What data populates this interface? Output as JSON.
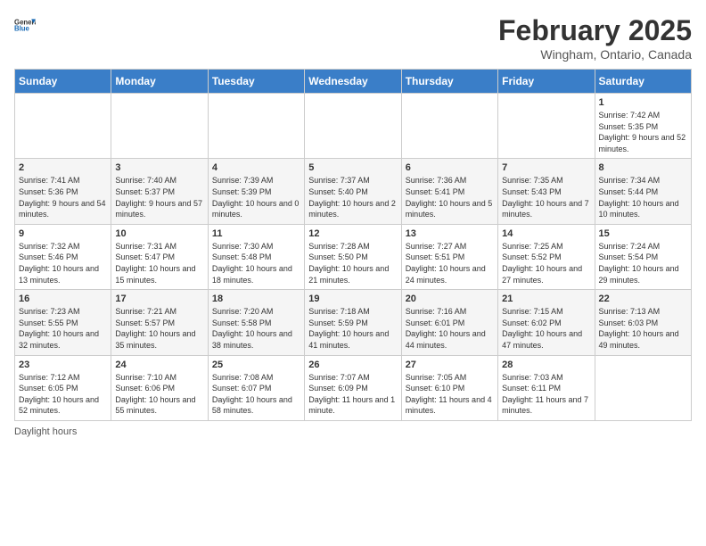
{
  "header": {
    "logo_line1": "General",
    "logo_line2": "Blue",
    "month_year": "February 2025",
    "location": "Wingham, Ontario, Canada"
  },
  "weekdays": [
    "Sunday",
    "Monday",
    "Tuesday",
    "Wednesday",
    "Thursday",
    "Friday",
    "Saturday"
  ],
  "weeks": [
    [
      {
        "day": "",
        "info": ""
      },
      {
        "day": "",
        "info": ""
      },
      {
        "day": "",
        "info": ""
      },
      {
        "day": "",
        "info": ""
      },
      {
        "day": "",
        "info": ""
      },
      {
        "day": "",
        "info": ""
      },
      {
        "day": "1",
        "info": "Sunrise: 7:42 AM\nSunset: 5:35 PM\nDaylight: 9 hours and 52 minutes."
      }
    ],
    [
      {
        "day": "2",
        "info": "Sunrise: 7:41 AM\nSunset: 5:36 PM\nDaylight: 9 hours and 54 minutes."
      },
      {
        "day": "3",
        "info": "Sunrise: 7:40 AM\nSunset: 5:37 PM\nDaylight: 9 hours and 57 minutes."
      },
      {
        "day": "4",
        "info": "Sunrise: 7:39 AM\nSunset: 5:39 PM\nDaylight: 10 hours and 0 minutes."
      },
      {
        "day": "5",
        "info": "Sunrise: 7:37 AM\nSunset: 5:40 PM\nDaylight: 10 hours and 2 minutes."
      },
      {
        "day": "6",
        "info": "Sunrise: 7:36 AM\nSunset: 5:41 PM\nDaylight: 10 hours and 5 minutes."
      },
      {
        "day": "7",
        "info": "Sunrise: 7:35 AM\nSunset: 5:43 PM\nDaylight: 10 hours and 7 minutes."
      },
      {
        "day": "8",
        "info": "Sunrise: 7:34 AM\nSunset: 5:44 PM\nDaylight: 10 hours and 10 minutes."
      }
    ],
    [
      {
        "day": "9",
        "info": "Sunrise: 7:32 AM\nSunset: 5:46 PM\nDaylight: 10 hours and 13 minutes."
      },
      {
        "day": "10",
        "info": "Sunrise: 7:31 AM\nSunset: 5:47 PM\nDaylight: 10 hours and 15 minutes."
      },
      {
        "day": "11",
        "info": "Sunrise: 7:30 AM\nSunset: 5:48 PM\nDaylight: 10 hours and 18 minutes."
      },
      {
        "day": "12",
        "info": "Sunrise: 7:28 AM\nSunset: 5:50 PM\nDaylight: 10 hours and 21 minutes."
      },
      {
        "day": "13",
        "info": "Sunrise: 7:27 AM\nSunset: 5:51 PM\nDaylight: 10 hours and 24 minutes."
      },
      {
        "day": "14",
        "info": "Sunrise: 7:25 AM\nSunset: 5:52 PM\nDaylight: 10 hours and 27 minutes."
      },
      {
        "day": "15",
        "info": "Sunrise: 7:24 AM\nSunset: 5:54 PM\nDaylight: 10 hours and 29 minutes."
      }
    ],
    [
      {
        "day": "16",
        "info": "Sunrise: 7:23 AM\nSunset: 5:55 PM\nDaylight: 10 hours and 32 minutes."
      },
      {
        "day": "17",
        "info": "Sunrise: 7:21 AM\nSunset: 5:57 PM\nDaylight: 10 hours and 35 minutes."
      },
      {
        "day": "18",
        "info": "Sunrise: 7:20 AM\nSunset: 5:58 PM\nDaylight: 10 hours and 38 minutes."
      },
      {
        "day": "19",
        "info": "Sunrise: 7:18 AM\nSunset: 5:59 PM\nDaylight: 10 hours and 41 minutes."
      },
      {
        "day": "20",
        "info": "Sunrise: 7:16 AM\nSunset: 6:01 PM\nDaylight: 10 hours and 44 minutes."
      },
      {
        "day": "21",
        "info": "Sunrise: 7:15 AM\nSunset: 6:02 PM\nDaylight: 10 hours and 47 minutes."
      },
      {
        "day": "22",
        "info": "Sunrise: 7:13 AM\nSunset: 6:03 PM\nDaylight: 10 hours and 49 minutes."
      }
    ],
    [
      {
        "day": "23",
        "info": "Sunrise: 7:12 AM\nSunset: 6:05 PM\nDaylight: 10 hours and 52 minutes."
      },
      {
        "day": "24",
        "info": "Sunrise: 7:10 AM\nSunset: 6:06 PM\nDaylight: 10 hours and 55 minutes."
      },
      {
        "day": "25",
        "info": "Sunrise: 7:08 AM\nSunset: 6:07 PM\nDaylight: 10 hours and 58 minutes."
      },
      {
        "day": "26",
        "info": "Sunrise: 7:07 AM\nSunset: 6:09 PM\nDaylight: 11 hours and 1 minute."
      },
      {
        "day": "27",
        "info": "Sunrise: 7:05 AM\nSunset: 6:10 PM\nDaylight: 11 hours and 4 minutes."
      },
      {
        "day": "28",
        "info": "Sunrise: 7:03 AM\nSunset: 6:11 PM\nDaylight: 11 hours and 7 minutes."
      },
      {
        "day": "",
        "info": ""
      }
    ]
  ],
  "footer": {
    "daylight_note": "Daylight hours"
  }
}
